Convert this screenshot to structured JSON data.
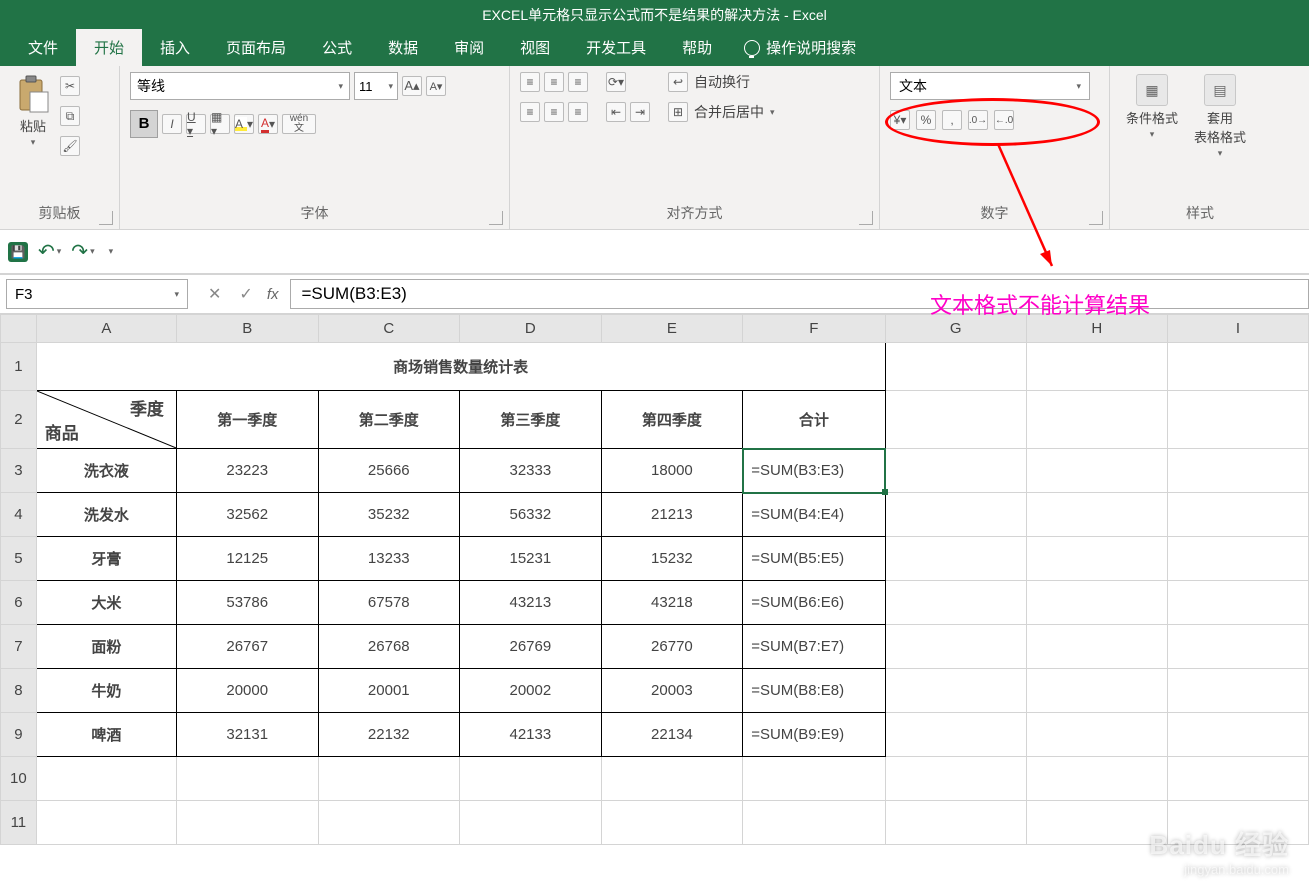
{
  "title": "EXCEL单元格只显示公式而不是结果的解决方法 - Excel",
  "menu": {
    "file": "文件",
    "home": "开始",
    "insert": "插入",
    "layout": "页面布局",
    "formulas": "公式",
    "data": "数据",
    "review": "审阅",
    "view": "视图",
    "dev": "开发工具",
    "help": "帮助",
    "tellme": "操作说明搜索"
  },
  "ribbon": {
    "clipboard": {
      "paste": "粘贴",
      "label": "剪贴板"
    },
    "font": {
      "name": "等线",
      "size": "11",
      "label": "字体",
      "pinyin": "wén\n文"
    },
    "align": {
      "wrap": "自动换行",
      "merge": "合并后居中",
      "label": "对齐方式"
    },
    "number": {
      "format": "文本",
      "label": "数字"
    },
    "styles": {
      "cond": "条件格式",
      "table": "套用\n表格格式",
      "label": "样式"
    }
  },
  "formula_bar": {
    "name_box": "F3",
    "formula": "=SUM(B3:E3)"
  },
  "columns": [
    "A",
    "B",
    "C",
    "D",
    "E",
    "F",
    "G",
    "H",
    "I"
  ],
  "sheet_title": "商场销售数量统计表",
  "diag": {
    "top": "季度",
    "bottom": "商品"
  },
  "col_headers": [
    "第一季度",
    "第二季度",
    "第三季度",
    "第四季度",
    "合计"
  ],
  "rows": [
    {
      "n": 3,
      "p": "洗衣液",
      "v": [
        "23223",
        "25666",
        "32333",
        "18000"
      ],
      "s": "=SUM(B3:E3)"
    },
    {
      "n": 4,
      "p": "洗发水",
      "v": [
        "32562",
        "35232",
        "56332",
        "21213"
      ],
      "s": "=SUM(B4:E4)"
    },
    {
      "n": 5,
      "p": "牙膏",
      "v": [
        "12125",
        "13233",
        "15231",
        "15232"
      ],
      "s": "=SUM(B5:E5)"
    },
    {
      "n": 6,
      "p": "大米",
      "v": [
        "53786",
        "67578",
        "43213",
        "43218"
      ],
      "s": "=SUM(B6:E6)"
    },
    {
      "n": 7,
      "p": "面粉",
      "v": [
        "26767",
        "26768",
        "26769",
        "26770"
      ],
      "s": "=SUM(B7:E7)"
    },
    {
      "n": 8,
      "p": "牛奶",
      "v": [
        "20000",
        "20001",
        "20002",
        "20003"
      ],
      "s": "=SUM(B8:E8)"
    },
    {
      "n": 9,
      "p": "啤酒",
      "v": [
        "32131",
        "22132",
        "42133",
        "22134"
      ],
      "s": "=SUM(B9:E9)"
    }
  ],
  "blank_rows": [
    10,
    11
  ],
  "annotation": "文本格式不能计算结果",
  "watermark": {
    "brand": "Baidu 经验",
    "url": "jingyan.baidu.com"
  }
}
